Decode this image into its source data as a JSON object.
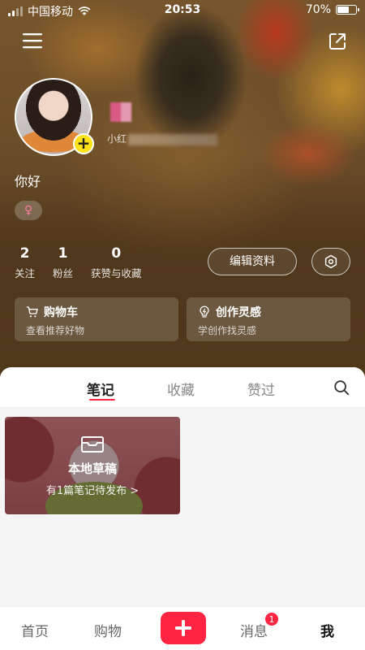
{
  "status_bar": {
    "carrier": "中国移动",
    "time": "20:53",
    "battery_percent": "70%",
    "battery_level": 0.7
  },
  "header": {
    "menu_icon": "hamburger-menu-icon",
    "share_icon": "share-export-icon"
  },
  "profile": {
    "user_id_prefix": "小红",
    "bio": "你好",
    "gender_symbol": "♀",
    "stats": [
      {
        "num": "2",
        "label": "关注"
      },
      {
        "num": "1",
        "label": "粉丝"
      },
      {
        "num": "0",
        "label": "获赞与收藏"
      }
    ],
    "edit_button": "编辑资料"
  },
  "cards": [
    {
      "title": "购物车",
      "subtitle": "查看推荐好物",
      "icon": "cart-icon"
    },
    {
      "title": "创作灵感",
      "subtitle": "学创作找灵感",
      "icon": "lightbulb-icon"
    }
  ],
  "tabs": [
    {
      "label": "笔记",
      "active": true
    },
    {
      "label": "收藏",
      "active": false
    },
    {
      "label": "赞过",
      "active": false
    }
  ],
  "draft": {
    "title": "本地草稿",
    "subtitle": "有1篇笔记待发布 >"
  },
  "bottom_nav": {
    "home": "首页",
    "shop": "购物",
    "messages": "消息",
    "messages_badge": "1",
    "me": "我"
  },
  "colors": {
    "accent": "#ff2442",
    "avatar_badge": "#ffe11a"
  }
}
